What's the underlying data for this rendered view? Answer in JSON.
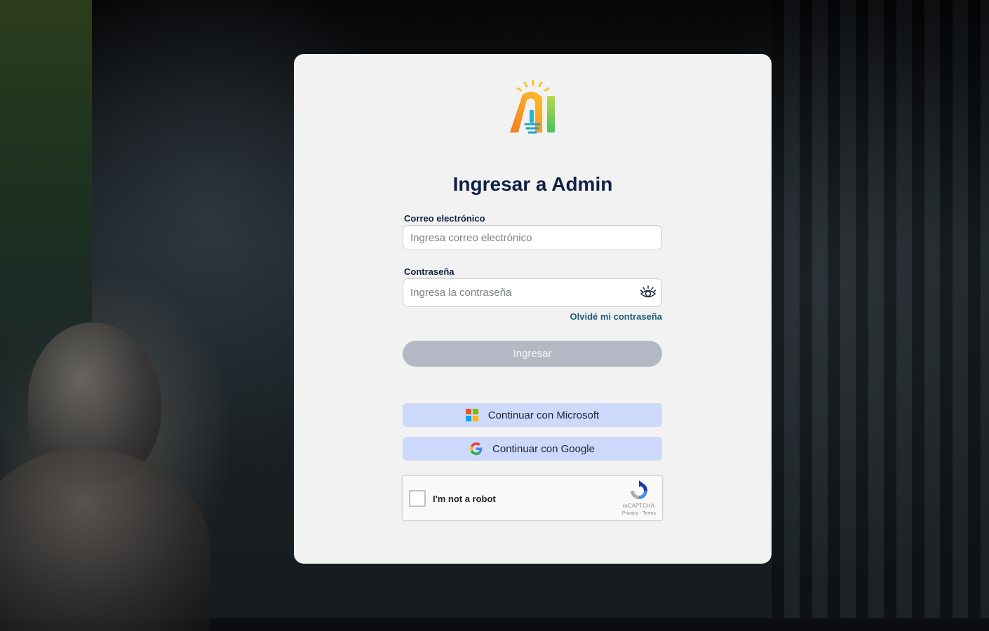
{
  "login": {
    "title": "Ingresar a Admin",
    "email": {
      "label": "Correo electrónico",
      "placeholder": "Ingresa correo electrónico",
      "value": ""
    },
    "password": {
      "label": "Contraseña",
      "placeholder": "Ingresa la contraseña",
      "value": ""
    },
    "forgot_label": "Olvidé mi contraseña",
    "submit_label": "Ingresar",
    "microsoft_label": "Continuar con Microsoft",
    "google_label": "Continuar con Google"
  },
  "recaptcha": {
    "label": "I'm not a robot",
    "brand": "reCAPTCHA",
    "privacy": "Privacy",
    "separator": " - ",
    "terms": "Terms"
  },
  "icons": {
    "logo": "ai-lightbulb-logo",
    "password_toggle": "eye-icon",
    "microsoft": "microsoft-logo-icon",
    "google": "google-logo-icon",
    "recaptcha": "recaptcha-icon"
  },
  "colors": {
    "title": "#0f1f45",
    "link": "#1e5b7a",
    "submit_disabled": "#b3b8c4",
    "sso_button": "#cdd9fb",
    "card": "#f2f2f2"
  }
}
